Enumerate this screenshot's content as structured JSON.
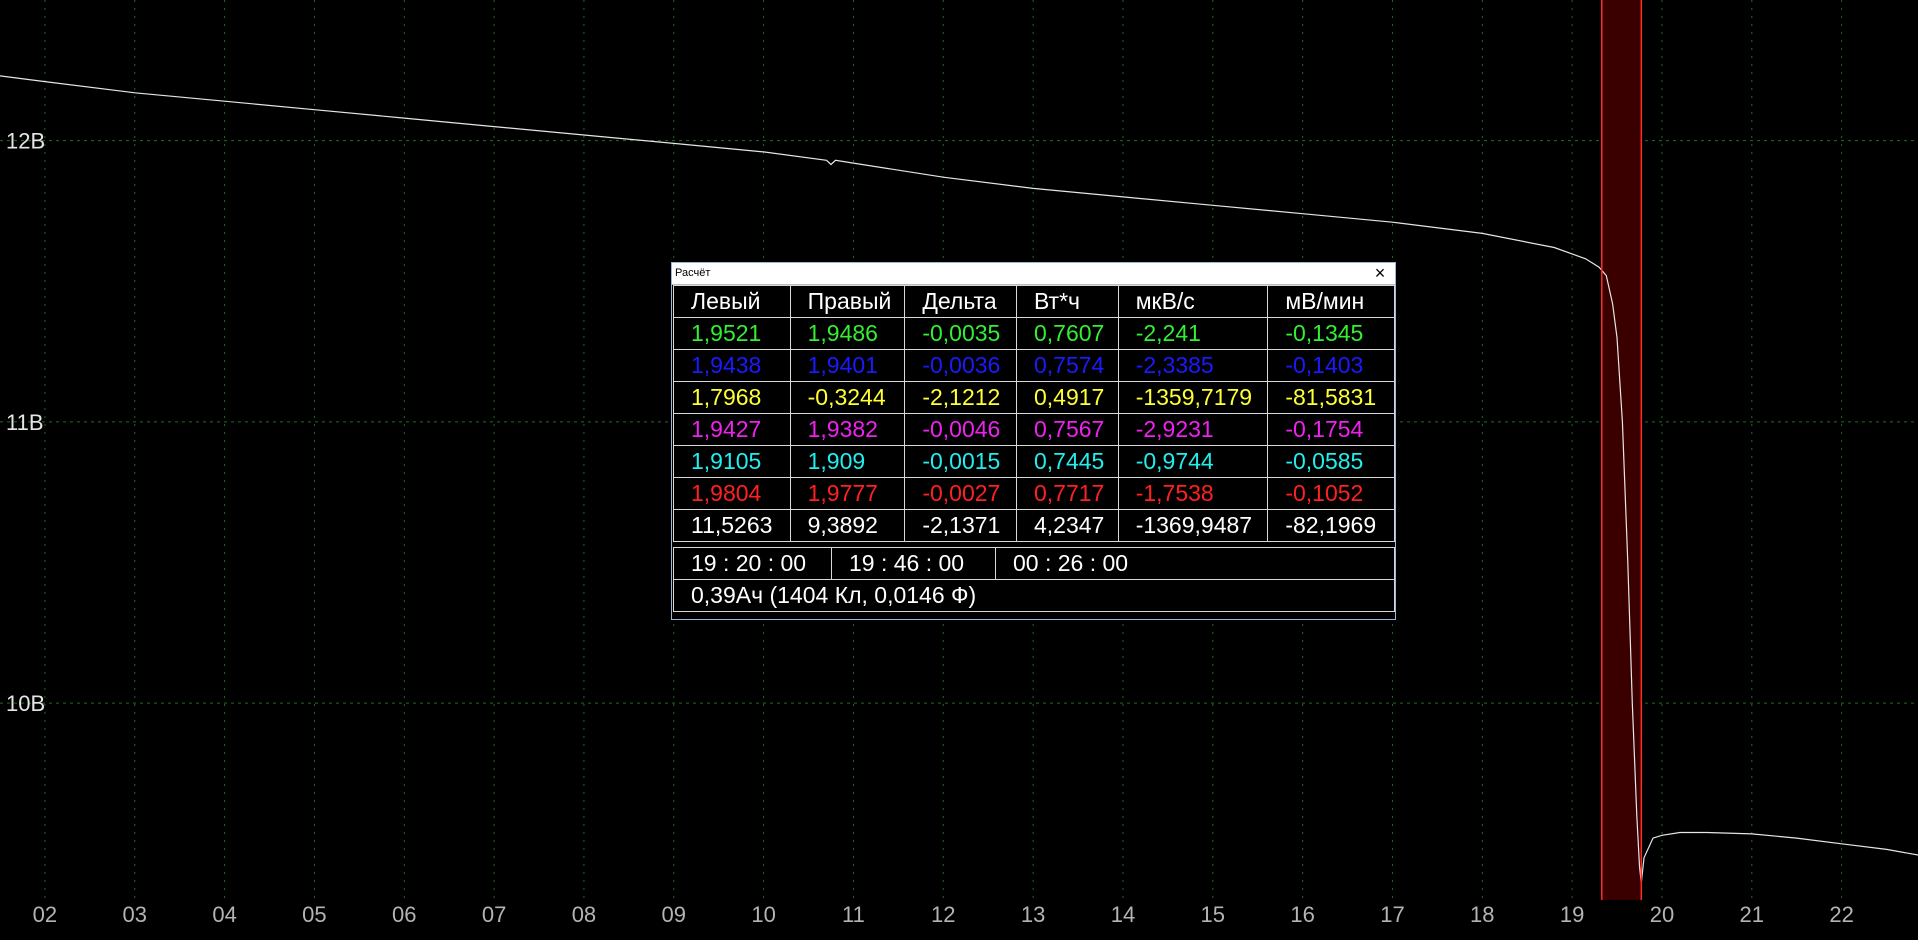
{
  "window": {
    "title": "Расчёт"
  },
  "chart_data": {
    "type": "line",
    "y_ticks": [
      "12В",
      "11В",
      "10В"
    ],
    "x_ticks": [
      "02",
      "03",
      "04",
      "05",
      "06",
      "07",
      "08",
      "09",
      "10",
      "11",
      "12",
      "13",
      "14",
      "15",
      "16",
      "17",
      "18",
      "19",
      "20",
      "21",
      "22"
    ],
    "grid": true,
    "ylim": [
      9.3,
      12.5
    ],
    "xlim": [
      1.5,
      22.85
    ],
    "colors": {
      "background": "#000000",
      "grid": "#1e6e1e",
      "line": "#e6e6e6",
      "cursor": "#ff2a2a",
      "selection": "#3a0000"
    },
    "cursors": {
      "left": 19.33,
      "right": 19.77
    },
    "series": [
      {
        "x": [
          1.5,
          2.0,
          3.0,
          4.0,
          5.0,
          6.0,
          7.0,
          8.0,
          9.0,
          10.0,
          10.7,
          10.75,
          10.8,
          11.0,
          12.0,
          13.0,
          14.0,
          15.0,
          16.0,
          17.0,
          18.0,
          18.8,
          19.15,
          19.3,
          19.38,
          19.45,
          19.5,
          19.56,
          19.62,
          19.67,
          19.72,
          19.75,
          19.77,
          19.8,
          19.9,
          20.0,
          20.2,
          20.5,
          21.0,
          21.5,
          22.0,
          22.5,
          22.85
        ],
        "y": [
          12.23,
          12.21,
          12.17,
          12.14,
          12.11,
          12.08,
          12.05,
          12.02,
          11.99,
          11.96,
          11.93,
          11.915,
          11.93,
          11.92,
          11.87,
          11.83,
          11.8,
          11.77,
          11.74,
          11.71,
          11.67,
          11.62,
          11.58,
          11.55,
          11.52,
          11.42,
          11.3,
          11.0,
          10.5,
          10.0,
          9.6,
          9.42,
          9.36,
          9.45,
          9.52,
          9.53,
          9.54,
          9.54,
          9.535,
          9.52,
          9.5,
          9.48,
          9.46
        ]
      }
    ]
  },
  "calc_table": {
    "headers": [
      "Левый",
      "Правый",
      "Дельта",
      "Вт*ч",
      "мкВ/с",
      "мВ/мин"
    ],
    "rows": [
      {
        "color": "#33ee33",
        "cells": [
          "1,9521",
          "1,9486",
          "-0,0035",
          "0,7607",
          "-2,241",
          "-0,1345"
        ]
      },
      {
        "color": "#1a1aff",
        "cells": [
          "1,9438",
          "1,9401",
          "-0,0036",
          "0,7574",
          "-2,3385",
          "-0,1403"
        ]
      },
      {
        "color": "#ffff33",
        "cells": [
          "1,7968",
          "-0,3244",
          "-2,1212",
          "0,4917",
          "-1359,7179",
          "-81,5831"
        ]
      },
      {
        "color": "#ee22ee",
        "cells": [
          "1,9427",
          "1,9382",
          "-0,0046",
          "0,7567",
          "-2,9231",
          "-0,1754"
        ]
      },
      {
        "color": "#22eeee",
        "cells": [
          "1,9105",
          "1,909",
          "-0,0015",
          "0,7445",
          "-0,9744",
          "-0,0585"
        ]
      },
      {
        "color": "#ff2020",
        "cells": [
          "1,9804",
          "1,9777",
          "-0,0027",
          "0,7717",
          "-1,7538",
          "-0,1052"
        ]
      },
      {
        "color": "#ffffff",
        "cells": [
          "11,5263",
          "9,3892",
          "-2,1371",
          "4,2347",
          "-1369,9487",
          "-82,1969"
        ]
      }
    ],
    "times": [
      "19 : 20 : 00",
      "19 : 46 : 00",
      "00 : 26 : 00"
    ],
    "summary": "0,39Ач (1404 Кл, 0,0146 Ф)"
  }
}
